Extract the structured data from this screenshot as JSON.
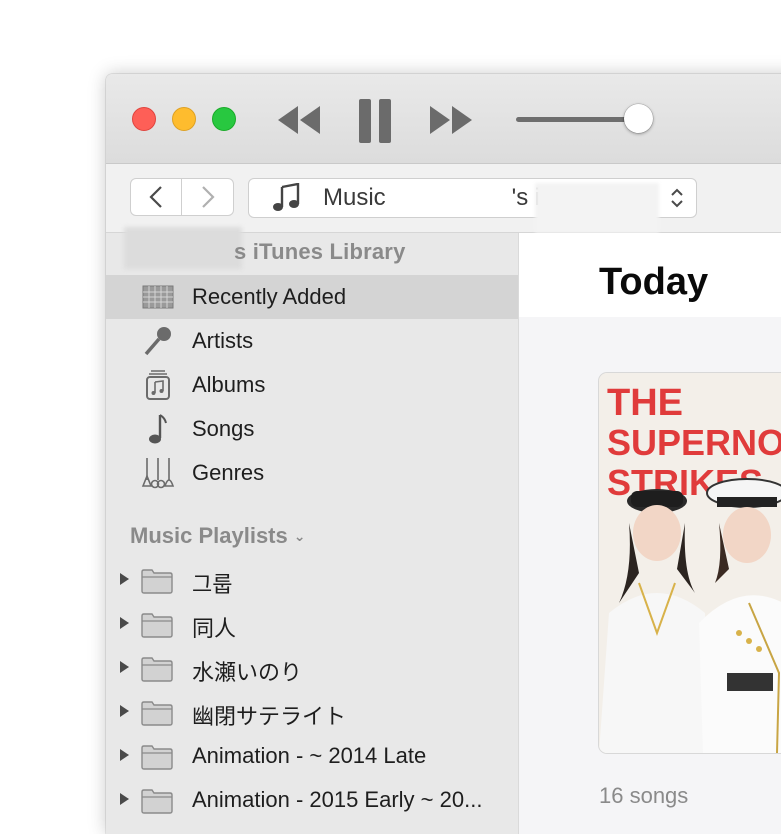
{
  "toolbar": {
    "source_label": "Music",
    "source_suffix": "'s iTunes..."
  },
  "sidebar": {
    "library_header": "s iTunes Library",
    "library_items": [
      {
        "label": "Recently Added",
        "icon": "recently-added-icon",
        "selected": true
      },
      {
        "label": "Artists",
        "icon": "microphone-icon"
      },
      {
        "label": "Albums",
        "icon": "album-icon"
      },
      {
        "label": "Songs",
        "icon": "music-note-icon"
      },
      {
        "label": "Genres",
        "icon": "guitars-icon"
      }
    ],
    "playlists_header": "Music Playlists",
    "playlists": [
      {
        "label": "그룹"
      },
      {
        "label": "同人"
      },
      {
        "label": "水瀬いのり"
      },
      {
        "label": "幽閉サテライト"
      },
      {
        "label": "Animation - ~ 2014 Late"
      },
      {
        "label": "Animation - 2015 Early ~ 20..."
      }
    ]
  },
  "main": {
    "heading": "Today",
    "album_art_text": [
      "THE",
      "SUPERNO",
      "STRIKES"
    ],
    "song_count": "16 songs"
  },
  "colors": {
    "close": "#fe5f57",
    "minimize": "#febc2e",
    "zoom": "#28c840",
    "art_text": "#e03b3b"
  }
}
